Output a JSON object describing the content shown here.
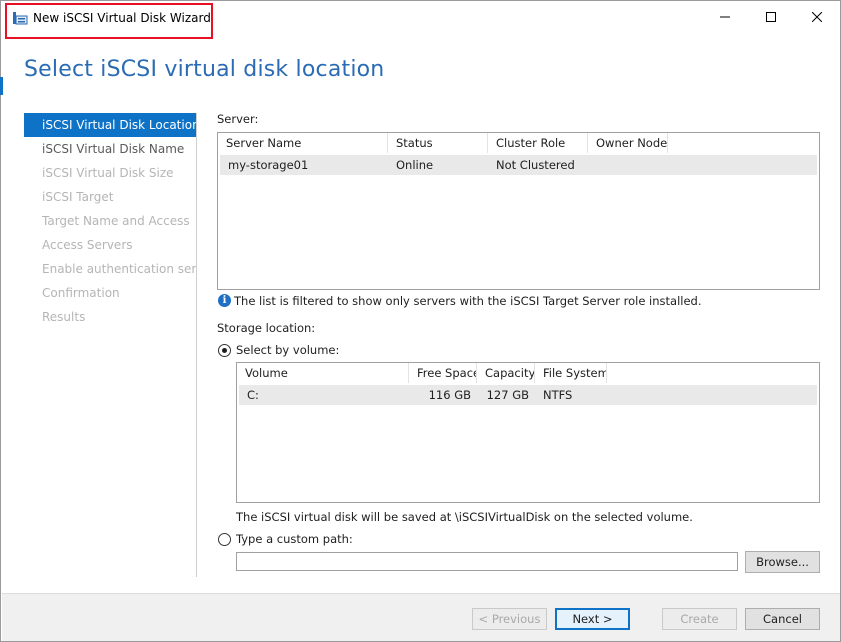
{
  "window": {
    "title": "New iSCSI Virtual Disk Wizard",
    "page_title": "Select iSCSI virtual disk location"
  },
  "nav": {
    "items": [
      {
        "label": "iSCSI Virtual Disk Location",
        "state": "selected"
      },
      {
        "label": "iSCSI Virtual Disk Name",
        "state": "visited"
      },
      {
        "label": "iSCSI Virtual Disk Size",
        "state": "disabled"
      },
      {
        "label": "iSCSI Target",
        "state": "disabled"
      },
      {
        "label": "Target Name and Access",
        "state": "disabled"
      },
      {
        "label": "Access Servers",
        "state": "disabled"
      },
      {
        "label": "Enable authentication ser...",
        "state": "disabled"
      },
      {
        "label": "Confirmation",
        "state": "disabled"
      },
      {
        "label": "Results",
        "state": "disabled"
      }
    ]
  },
  "server": {
    "label": "Server:",
    "columns": [
      "Server Name",
      "Status",
      "Cluster Role",
      "Owner Node"
    ],
    "rows": [
      [
        "my-storage01",
        "Online",
        "Not Clustered",
        ""
      ]
    ],
    "info_text": "The list is filtered to show only servers with the iSCSI Target Server role installed."
  },
  "storage": {
    "label": "Storage location:",
    "by_volume_label": "Select by volume:",
    "columns": [
      "Volume",
      "Free Space",
      "Capacity",
      "File System"
    ],
    "rows": [
      [
        "C:",
        "116 GB",
        "127 GB",
        "NTFS"
      ]
    ],
    "save_note": "The iSCSI virtual disk will be saved at \\iSCSIVirtualDisk on the selected volume.",
    "custom_path_label": "Type a custom path:",
    "custom_path_value": "",
    "browse_label": "Browse..."
  },
  "footer": {
    "previous_label": "< Previous",
    "next_label": "Next >",
    "create_label": "Create",
    "cancel_label": "Cancel"
  },
  "colors": {
    "accent": "#0e72c6",
    "title_blue": "#2a6bb3",
    "highlight_red": "#e81123"
  },
  "icons": {
    "app": "disk-wizard-icon",
    "info": "info-icon"
  }
}
